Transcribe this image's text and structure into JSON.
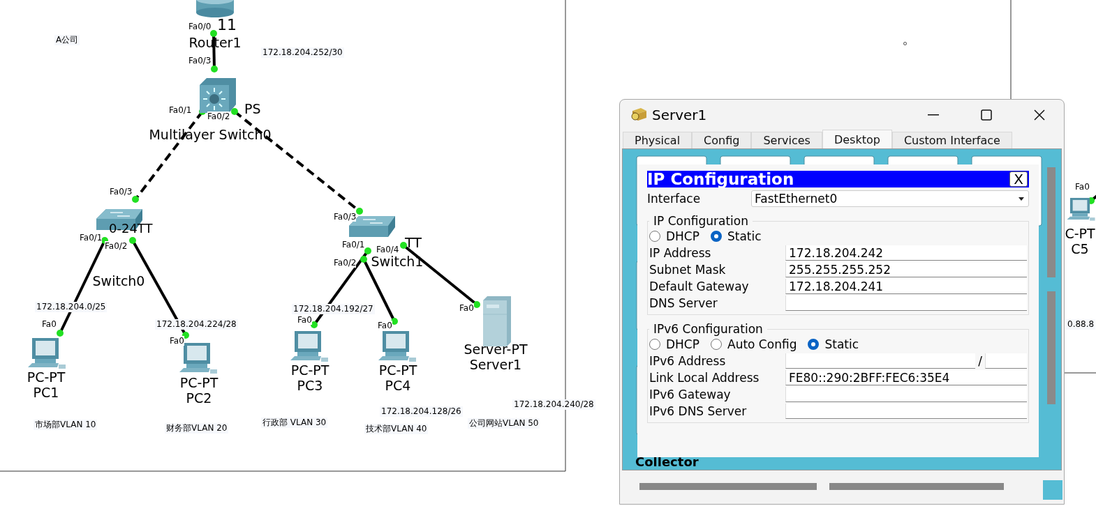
{
  "topology": {
    "devices": [
      {
        "kind": "router",
        "model": "11",
        "name": "Router1"
      },
      {
        "kind": "multilayer-switch",
        "model": "PS",
        "name": "Multilayer Switch0"
      },
      {
        "kind": "switch",
        "model": "0-24TT",
        "name": "Switch0"
      },
      {
        "kind": "switch",
        "model": "TT",
        "name": "Switch1"
      },
      {
        "kind": "pc",
        "model": "PC-PT",
        "name": "PC1"
      },
      {
        "kind": "pc",
        "model": "PC-PT",
        "name": "PC2"
      },
      {
        "kind": "pc",
        "model": "PC-PT",
        "name": "PC3"
      },
      {
        "kind": "pc",
        "model": "PC-PT",
        "name": "PC4"
      },
      {
        "kind": "server",
        "model": "Server-PT",
        "name": "Server1"
      },
      {
        "kind": "pc",
        "model": "C-PT",
        "name": "C5"
      }
    ],
    "links": [
      {
        "kind": "straight",
        "ports": [
          "Fa0/0",
          "Fa0/3"
        ]
      },
      {
        "kind": "crossover",
        "ports": [
          "Fa0/1",
          "Fa0/3"
        ]
      },
      {
        "kind": "crossover",
        "ports": [
          "Fa0/2",
          "Fa0/3"
        ]
      },
      {
        "kind": "straight",
        "ports": [
          "Fa0/1",
          "Fa0"
        ]
      },
      {
        "kind": "straight",
        "ports": [
          "Fa0/2",
          "Fa0"
        ]
      },
      {
        "kind": "straight",
        "ports": [
          "Fa0/1",
          "Fa0"
        ]
      },
      {
        "kind": "straight",
        "ports": [
          "Fa0/2",
          "Fa0"
        ]
      },
      {
        "kind": "straight",
        "ports": [
          "Fa0/4",
          "Fa0"
        ]
      },
      {
        "kind": "straight",
        "ports": [
          "Fa0"
        ]
      }
    ],
    "notes": [
      "A公司",
      "172.18.204.252/30",
      "172.18.204.0/25",
      "172.18.204.224/28",
      "172.18.204.192/27",
      "172.18.204.128/26",
      "172.18.204.240/28",
      "市场部VLAN 10",
      "财务部VLAN 20",
      "行政部 VLAN 30",
      "技术部VLAN 40",
      "公司网站VLAN 50",
      "0.88.8"
    ]
  },
  "window": {
    "title": "Server1",
    "tabs": [
      {
        "label": "Physical",
        "selected": false
      },
      {
        "label": "Config",
        "selected": false
      },
      {
        "label": "Services",
        "selected": false
      },
      {
        "label": "Desktop",
        "selected": true
      },
      {
        "label": "Custom Interface",
        "selected": false
      }
    ],
    "panel": {
      "title": "IP Configuration",
      "close": "X",
      "interface_label": "Interface",
      "interface": "FastEthernet0",
      "ipv4": {
        "legend": "IP Configuration",
        "modes": [
          {
            "label": "DHCP",
            "selected": false
          },
          {
            "label": "Static",
            "selected": true
          }
        ],
        "fields": [
          {
            "kind": "plain",
            "label": "IP Address",
            "value": "172.18.204.242"
          },
          {
            "kind": "plain",
            "label": "Subnet Mask",
            "value": "255.255.255.252"
          },
          {
            "kind": "plain",
            "label": "Default Gateway",
            "value": "172.18.204.241"
          },
          {
            "kind": "plain",
            "label": "DNS Server"
          }
        ]
      },
      "ipv6": {
        "legend": "IPv6 Configuration",
        "modes": [
          {
            "label": "DHCP",
            "selected": false
          },
          {
            "label": "Auto Config",
            "selected": false
          },
          {
            "label": "Static",
            "selected": true
          }
        ],
        "fields": [
          {
            "kind": "prefixed",
            "label": "IPv6 Address",
            "separator": "/"
          },
          {
            "kind": "plain",
            "label": "Link Local Address",
            "value": "FE80::290:2BFF:FEC6:35E4"
          },
          {
            "kind": "plain",
            "label": "IPv6 Gateway"
          },
          {
            "kind": "plain",
            "label": "IPv6 DNS Server"
          }
        ]
      }
    },
    "desktop_caption": "Collector"
  }
}
